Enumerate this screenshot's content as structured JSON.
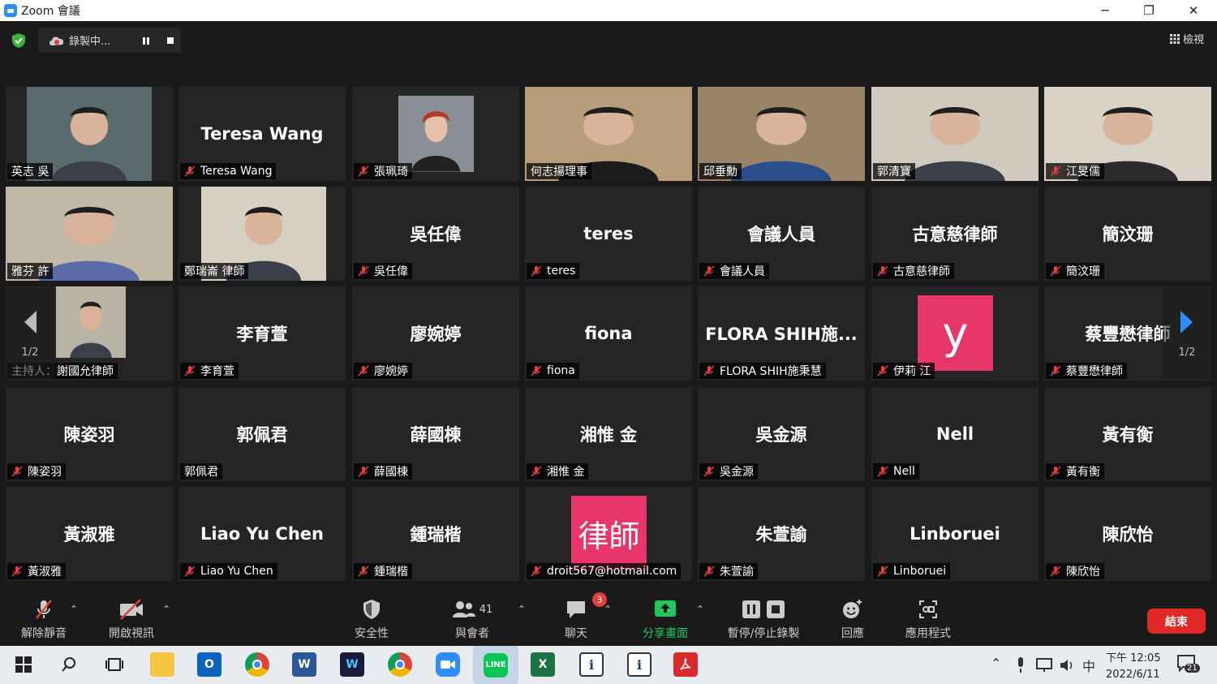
{
  "window": {
    "title": "Zoom 會議",
    "minimize": "─",
    "restore": "❐",
    "close": "✕"
  },
  "recording": {
    "label": "錄製中..."
  },
  "view": {
    "label": "檢視"
  },
  "pager": {
    "left": "1/2",
    "right": "1/2"
  },
  "participants": [
    {
      "display": "",
      "name": "英志 吳",
      "muted": false,
      "video": "photo"
    },
    {
      "display": "Teresa Wang",
      "name": "Teresa Wang",
      "muted": true,
      "video": "none"
    },
    {
      "display": "",
      "name": "張珮琦",
      "muted": true,
      "video": "portrait"
    },
    {
      "display": "",
      "name": "何志揚理事",
      "muted": false,
      "video": "photo"
    },
    {
      "display": "",
      "name": "邱垂勳",
      "muted": false,
      "video": "photo"
    },
    {
      "display": "",
      "name": "郭清寶",
      "muted": false,
      "video": "photo",
      "active": true
    },
    {
      "display": "",
      "name": "江旻儒",
      "muted": true,
      "video": "photo"
    },
    {
      "display": "",
      "name": "雅芬 許",
      "muted": false,
      "video": "photo"
    },
    {
      "display": "",
      "name": "鄭瑞崙 律師",
      "muted": false,
      "video": "photo"
    },
    {
      "display": "吳任偉",
      "name": "吳任偉",
      "muted": true,
      "video": "none"
    },
    {
      "display": "teres",
      "name": "teres",
      "muted": true,
      "video": "none"
    },
    {
      "display": "會議人員",
      "name": "會議人員",
      "muted": true,
      "video": "none"
    },
    {
      "display": "古意慈律師",
      "name": "古意慈律師",
      "muted": true,
      "video": "none"
    },
    {
      "display": "簡汶珊",
      "name": "簡汶珊",
      "muted": true,
      "video": "none"
    },
    {
      "display": "",
      "name": "主持人：謝國允律師",
      "muted": false,
      "video": "photo"
    },
    {
      "display": "李育萱",
      "name": "李育萱",
      "muted": true,
      "video": "none"
    },
    {
      "display": "廖婉婷",
      "name": "廖婉婷",
      "muted": true,
      "video": "none"
    },
    {
      "display": "fiona",
      "name": "fiona",
      "muted": true,
      "video": "none"
    },
    {
      "display": "FLORA SHIH施...",
      "name": "FLORA SHIH施秉慧",
      "muted": true,
      "video": "none"
    },
    {
      "display": "y",
      "name": "伊莉 江",
      "muted": true,
      "video": "avatar",
      "avatar_color": "#e8356a"
    },
    {
      "display": "蔡豐懋律師",
      "name": "蔡豐懋律師",
      "muted": true,
      "video": "none"
    },
    {
      "display": "陳姿羽",
      "name": "陳姿羽",
      "muted": true,
      "video": "none"
    },
    {
      "display": "郭佩君",
      "name": "郭佩君",
      "muted": false,
      "video": "none"
    },
    {
      "display": "薛國棟",
      "name": "薛國棟",
      "muted": true,
      "video": "none"
    },
    {
      "display": "湘惟 金",
      "name": "湘惟 金",
      "muted": true,
      "video": "none"
    },
    {
      "display": "吳金源",
      "name": "吳金源",
      "muted": true,
      "video": "none"
    },
    {
      "display": "Nell",
      "name": "Nell",
      "muted": true,
      "video": "none"
    },
    {
      "display": "黃有衡",
      "name": "黃有衡",
      "muted": true,
      "video": "none"
    },
    {
      "display": "黃淑雅",
      "name": "黃淑雅",
      "muted": true,
      "video": "none"
    },
    {
      "display": "Liao Yu Chen",
      "name": "Liao Yu Chen",
      "muted": true,
      "video": "none"
    },
    {
      "display": "鍾瑞楷",
      "name": "鍾瑞楷",
      "muted": true,
      "video": "none"
    },
    {
      "display": "律師",
      "name": "droit567@hotmail.com",
      "muted": true,
      "video": "avatar",
      "avatar_color": "#e8356a"
    },
    {
      "display": "朱萱諭",
      "name": "朱萱諭",
      "muted": true,
      "video": "none"
    },
    {
      "display": "Linboruei",
      "name": "Linboruei",
      "muted": true,
      "video": "none"
    },
    {
      "display": "陳欣怡",
      "name": "陳欣怡",
      "muted": true,
      "video": "none"
    }
  ],
  "toolbar": {
    "unmute": "解除靜音",
    "start_video": "開啟視訊",
    "security": "安全性",
    "participants": "與會者",
    "participants_count": "41",
    "chat": "聊天",
    "chat_badge": "3",
    "share": "分享畫面",
    "record": "暫停/停止錄製",
    "reactions": "回應",
    "apps": "應用程式",
    "end": "結束"
  },
  "taskbar": {
    "time": "下午 12:05",
    "date": "2022/6/11",
    "ime": "中",
    "notifications": "21"
  },
  "colors": {
    "accent_green": "#23c55e",
    "end_red": "#e02828",
    "active_border": "#e4f05a",
    "zoom_blue": "#2d8cff"
  }
}
